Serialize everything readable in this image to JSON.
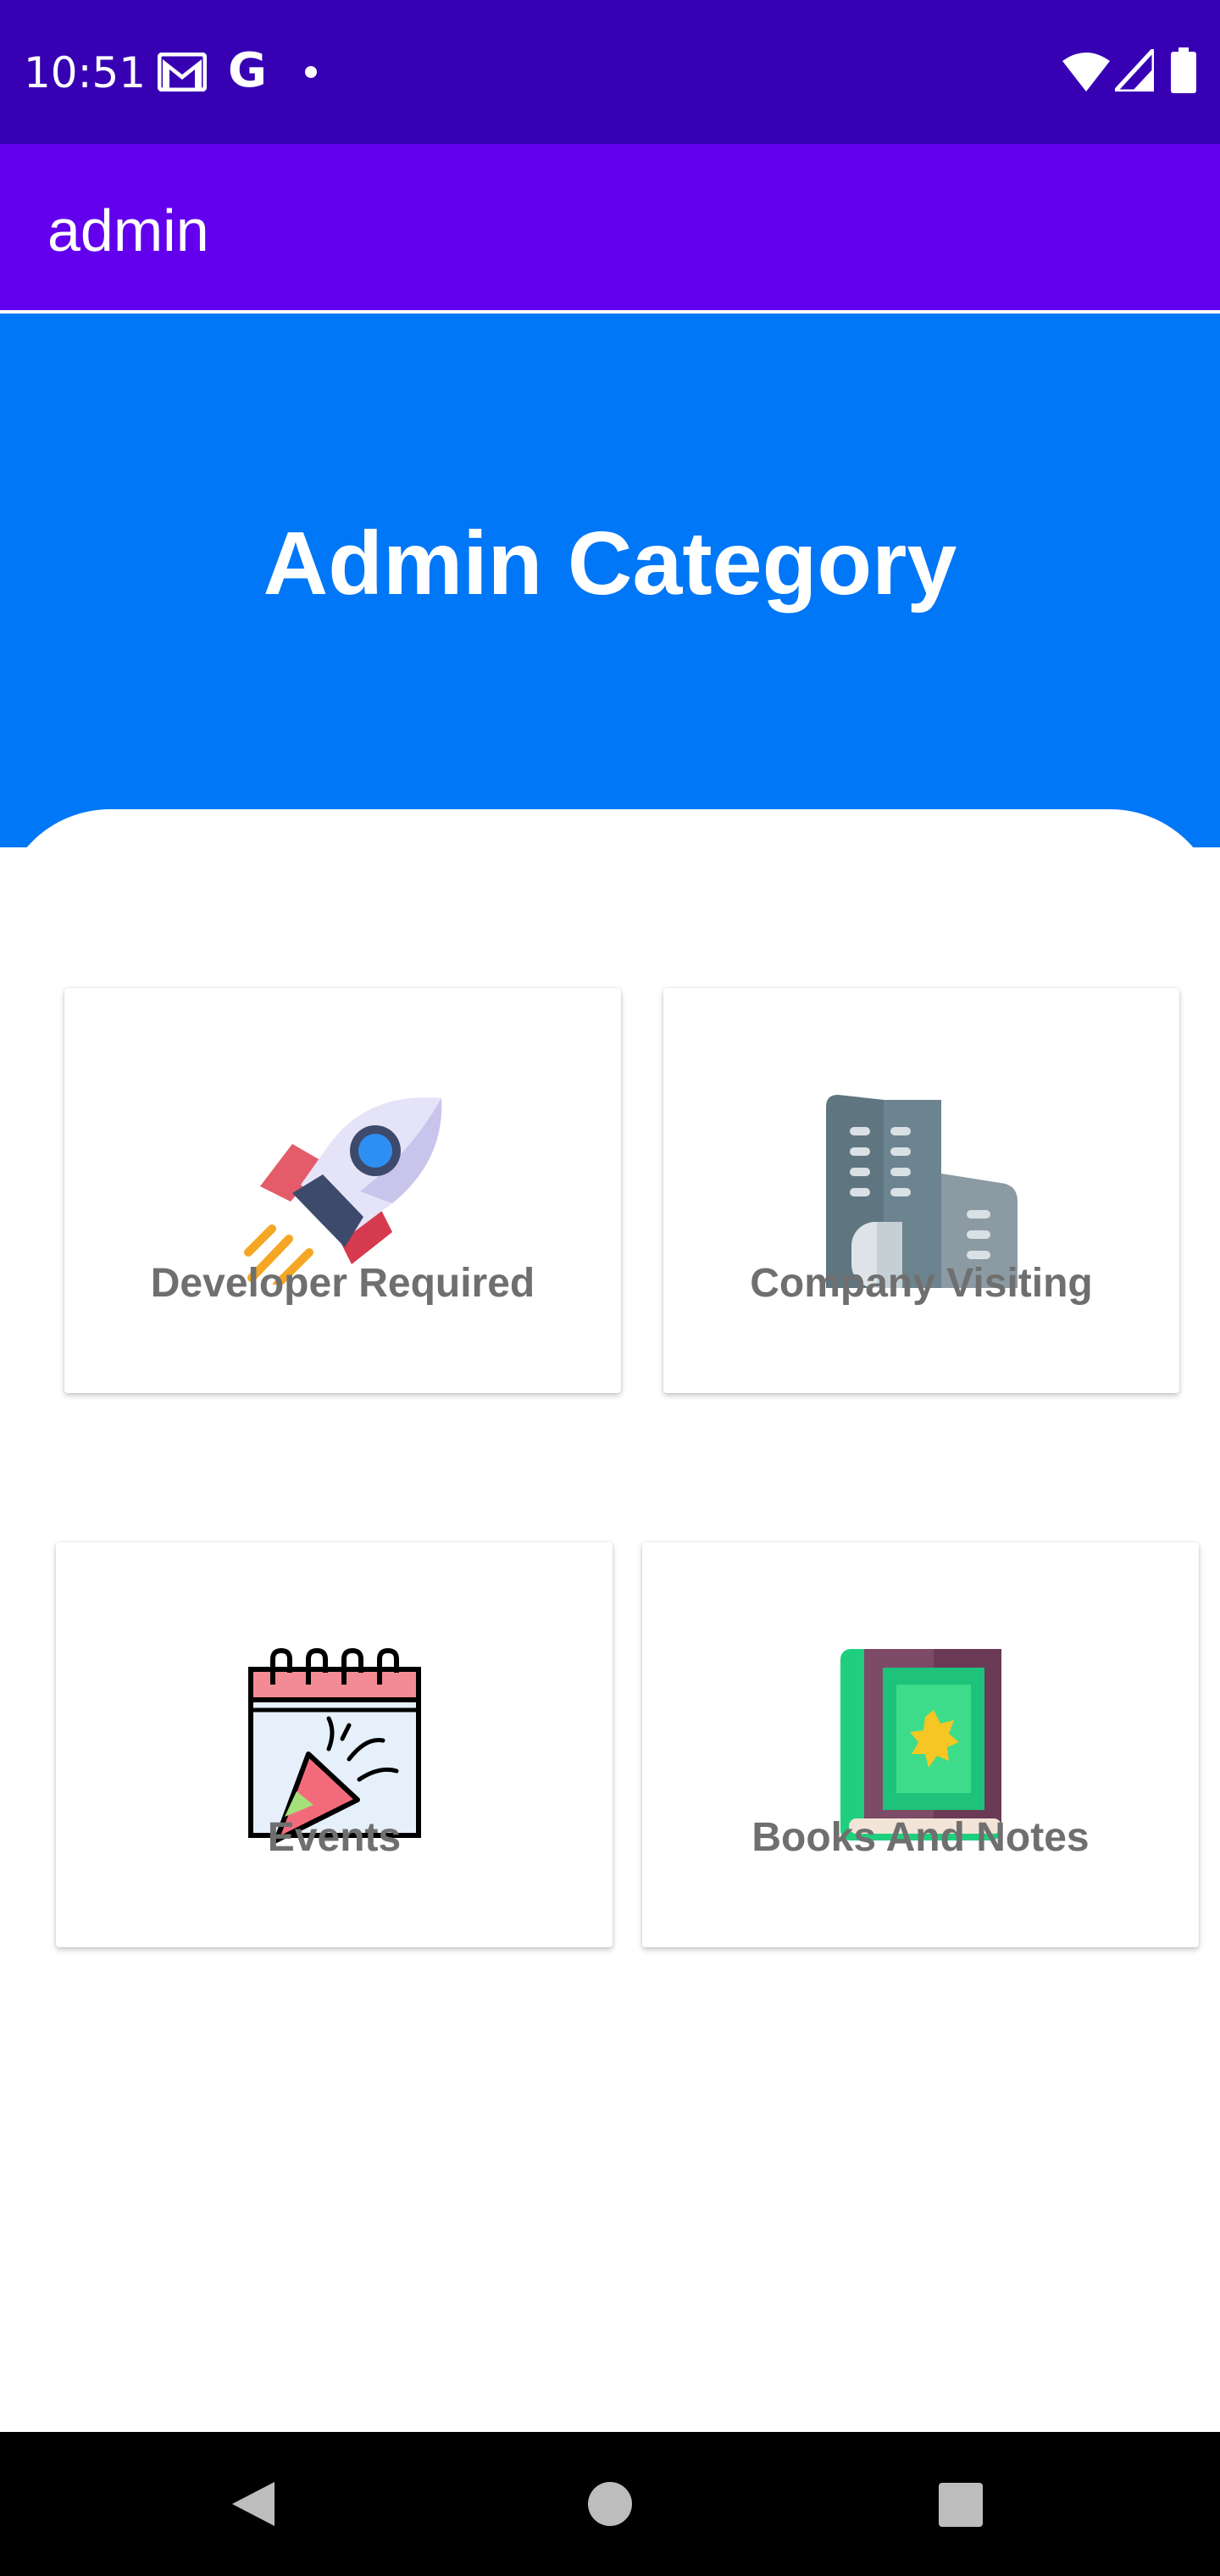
{
  "status_bar": {
    "time": "10:51",
    "notification_icons": [
      "gmail-icon",
      "google-icon",
      "dot-icon"
    ],
    "system_icons": [
      "wifi-icon",
      "signal-icon",
      "battery-icon"
    ],
    "g_glyph": "G"
  },
  "app_bar": {
    "title": "admin"
  },
  "header": {
    "title": "Admin Category"
  },
  "categories": [
    {
      "label": "Developer Required",
      "icon": "rocket-icon"
    },
    {
      "label": "Company Visiting",
      "icon": "building-icon"
    },
    {
      "label": "Events",
      "icon": "calendar-party-icon"
    },
    {
      "label": "Books And Notes",
      "icon": "book-icon"
    }
  ],
  "nav_bar": {
    "buttons": [
      "back-icon",
      "home-icon",
      "recents-icon"
    ]
  },
  "colors": {
    "status_bar": "#3700b3",
    "app_bar": "#6200ee",
    "header": "#0077f7",
    "card_label": "#6f6f6f"
  }
}
